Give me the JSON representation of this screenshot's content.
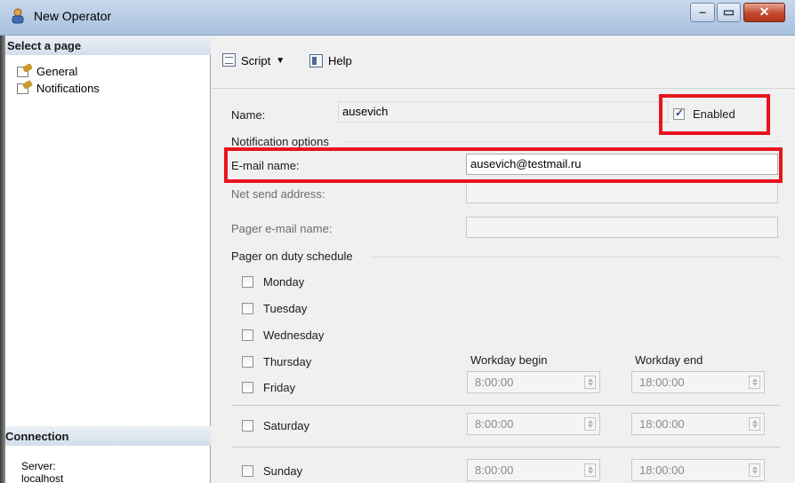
{
  "window": {
    "title": "New Operator",
    "accent_color": "#e8141d"
  },
  "left_panel": {
    "select_page_header": "Select a page",
    "pages": [
      {
        "label": "General",
        "icon": "page-wrench-icon"
      },
      {
        "label": "Notifications",
        "icon": "page-wrench-icon"
      }
    ],
    "connection_header": "Connection",
    "server_label": "Server:",
    "server_value": "localhost"
  },
  "toolbar": {
    "script_label": "Script",
    "help_label": "Help"
  },
  "form": {
    "name_label": "Name:",
    "name_value": "ausevich",
    "enabled_label": "Enabled",
    "enabled_checked": true,
    "notification_group": "Notification options",
    "email_label": "E-mail name:",
    "email_value": "ausevich@testmail.ru",
    "net_send_label": "Net send address:",
    "net_send_value": "",
    "pager_email_label": "Pager e-mail name:",
    "pager_email_value": "",
    "pager_group": "Pager on duty schedule",
    "days": [
      {
        "label": "Monday",
        "checked": false
      },
      {
        "label": "Tuesday",
        "checked": false
      },
      {
        "label": "Wednesday",
        "checked": false
      },
      {
        "label": "Thursday",
        "checked": false
      },
      {
        "label": "Friday",
        "checked": false
      },
      {
        "label": "Saturday",
        "checked": false
      },
      {
        "label": "Sunday",
        "checked": false
      }
    ],
    "workday_begin_label": "Workday begin",
    "workday_end_label": "Workday end",
    "weekday_begin": "8:00:00",
    "weekday_end": "18:00:00",
    "saturday_begin": "8:00:00",
    "saturday_end": "18:00:00",
    "sunday_begin": "8:00:00",
    "sunday_end": "18:00:00"
  }
}
